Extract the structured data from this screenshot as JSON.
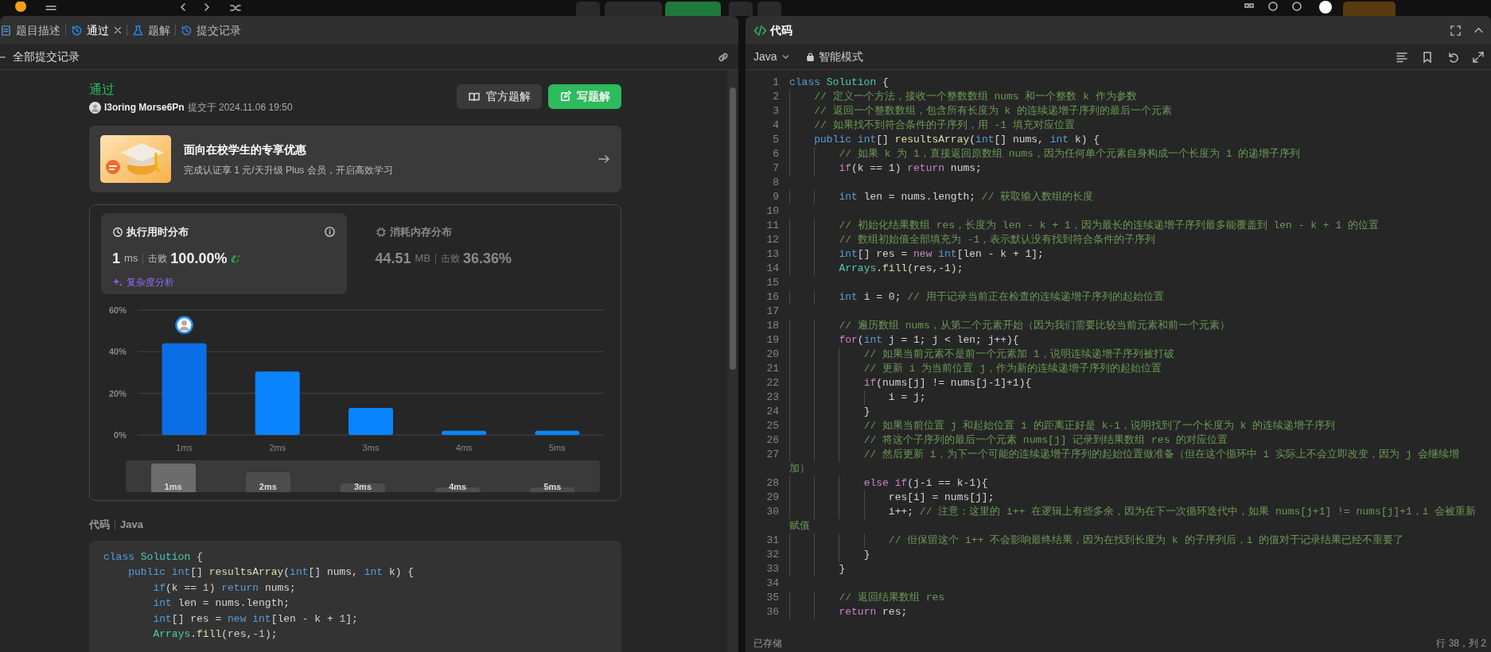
{
  "left_panel": {
    "tabs": [
      {
        "label": "题目描述",
        "kind": "description",
        "selected": false,
        "closable": false
      },
      {
        "label": "通过",
        "kind": "result",
        "selected": true,
        "closable": true
      },
      {
        "label": "题解",
        "kind": "solutions",
        "selected": false,
        "closable": false
      },
      {
        "label": "提交记录",
        "kind": "submissions",
        "selected": false,
        "closable": false
      }
    ],
    "back_link": "全部提交记录",
    "submission": {
      "status": "通过",
      "user": "l3oring Morse6Pn",
      "submitted_at": "提交于 2024.11.06 19:50"
    },
    "buttons": [
      {
        "label": "官方题解",
        "kind": "official"
      },
      {
        "label": "写题解",
        "kind": "write"
      }
    ],
    "promo": {
      "title": "面向在校学生的专享优惠",
      "subtitle": "完成认证享 1 元/天升级 Plus 会员，开启高效学习"
    },
    "stats": [
      {
        "kind": "runtime",
        "selected": true,
        "title": "执行用时分布",
        "value": "1",
        "unit": "ms",
        "beat_label": "击败",
        "percent": "100.00%",
        "link": "复杂度分析"
      },
      {
        "kind": "memory",
        "selected": false,
        "title": "消耗内存分布",
        "value": "44.51",
        "unit": "MB",
        "beat_label": "击败",
        "percent": "36.36%"
      }
    ],
    "runtime_chart": {
      "chart_data": {
        "type": "bar",
        "categories": [
          "1ms",
          "2ms",
          "3ms",
          "4ms",
          "5ms"
        ],
        "values": [
          44,
          30.5,
          13,
          2,
          2
        ],
        "ylim": [
          0,
          60
        ],
        "yticks": [
          {
            "value": 0,
            "label": "0%"
          },
          {
            "value": 20,
            "label": "20%"
          },
          {
            "value": 40,
            "label": "40%"
          },
          {
            "value": 60,
            "label": "60%"
          }
        ]
      },
      "navigator": [
        {
          "label": "1ms",
          "selected": true
        },
        {
          "label": "2ms",
          "selected": false
        },
        {
          "label": "3ms",
          "selected": false
        },
        {
          "label": "4ms",
          "selected": false
        },
        {
          "label": "5ms",
          "selected": false
        }
      ]
    },
    "code_title": "代码",
    "code_language": "Java",
    "code": [
      {
        "tokens": [
          {
            "kind": "keyword",
            "text": "class"
          },
          {
            "kind": "class",
            "text": " Solution"
          },
          {
            "kind": "plain",
            "text": " {"
          }
        ]
      },
      {
        "tokens": [
          {
            "kind": "keyword",
            "text": "    public"
          },
          {
            "kind": "keyword",
            "text": " int"
          },
          {
            "kind": "plain",
            "text": "[] "
          },
          {
            "kind": "function",
            "text": "resultsArray"
          },
          {
            "kind": "plain",
            "text": "("
          },
          {
            "kind": "keyword",
            "text": "int"
          },
          {
            "kind": "plain",
            "text": "[] nums, "
          },
          {
            "kind": "keyword",
            "text": "int"
          },
          {
            "kind": "plain",
            "text": " k) {"
          }
        ]
      },
      {
        "tokens": [
          {
            "kind": "keyword",
            "text": "        if"
          },
          {
            "kind": "plain",
            "text": "(k == "
          },
          {
            "kind": "number",
            "text": "1"
          },
          {
            "kind": "plain",
            "text": ") "
          },
          {
            "kind": "keyword",
            "text": "return"
          },
          {
            "kind": "plain",
            "text": " nums;"
          }
        ]
      },
      {
        "tokens": [
          {
            "kind": "keyword",
            "text": "        int"
          },
          {
            "kind": "plain",
            "text": " len = nums.length;"
          }
        ]
      },
      {
        "tokens": [
          {
            "kind": "keyword",
            "text": "        int"
          },
          {
            "kind": "plain",
            "text": "[] res = "
          },
          {
            "kind": "keyword",
            "text": "new"
          },
          {
            "kind": "keyword",
            "text": " int"
          },
          {
            "kind": "plain",
            "text": "[len - k + "
          },
          {
            "kind": "number",
            "text": "1"
          },
          {
            "kind": "plain",
            "text": "];"
          }
        ]
      },
      {
        "tokens": [
          {
            "kind": "class",
            "text": "        Arrays"
          },
          {
            "kind": "plain",
            "text": "."
          },
          {
            "kind": "function",
            "text": "fill"
          },
          {
            "kind": "plain",
            "text": "(res,-"
          },
          {
            "kind": "number",
            "text": "1"
          },
          {
            "kind": "plain",
            "text": ");"
          }
        ]
      }
    ]
  },
  "editor": {
    "title": "代码",
    "language": "Java",
    "mode": "智能模式",
    "lines": [
      {
        "n": "1",
        "tokens": [
          {
            "kind": "keyword",
            "text": "class"
          },
          {
            "kind": "class",
            "text": " Solution"
          },
          {
            "kind": "plain",
            "text": " {"
          }
        ]
      },
      {
        "n": "2",
        "tokens": [
          {
            "kind": "comment",
            "text": "    // 定义一个方法，接收一个整数数组 nums 和一个整数 k 作为参数"
          }
        ]
      },
      {
        "n": "3",
        "tokens": [
          {
            "kind": "comment",
            "text": "    // 返回一个整数数组，包含所有长度为 k 的连续递增子序列的最后一个元素"
          }
        ]
      },
      {
        "n": "4",
        "tokens": [
          {
            "kind": "comment",
            "text": "    // 如果找不到符合条件的子序列，用 -1 填充对应位置"
          }
        ]
      },
      {
        "n": "5",
        "tokens": [
          {
            "kind": "keyword",
            "text": "    public"
          },
          {
            "kind": "keyword",
            "text": " int"
          },
          {
            "kind": "plain",
            "text": "[] "
          },
          {
            "kind": "function",
            "text": "resultsArray"
          },
          {
            "kind": "plain",
            "text": "("
          },
          {
            "kind": "keyword",
            "text": "int"
          },
          {
            "kind": "plain",
            "text": "[] nums, "
          },
          {
            "kind": "keyword",
            "text": "int"
          },
          {
            "kind": "plain",
            "text": " k) {"
          }
        ]
      },
      {
        "n": "6",
        "tokens": [
          {
            "kind": "comment",
            "text": "        // 如果 k 为 1，直接返回原数组 nums，因为任何单个元素自身构成一个长度为 1 的递增子序列"
          }
        ]
      },
      {
        "n": "7",
        "tokens": [
          {
            "kind": "control",
            "text": "        if"
          },
          {
            "kind": "plain",
            "text": "(k == 1) "
          },
          {
            "kind": "control",
            "text": "return"
          },
          {
            "kind": "plain",
            "text": " nums;"
          }
        ]
      },
      {
        "n": "8"
      },
      {
        "n": "9",
        "tokens": [
          {
            "kind": "keyword",
            "text": "        int"
          },
          {
            "kind": "plain",
            "text": " len = nums.length; "
          },
          {
            "kind": "comment",
            "text": "// 获取输入数组的长度"
          }
        ]
      },
      {
        "n": "10"
      },
      {
        "n": "11",
        "tokens": [
          {
            "kind": "comment",
            "text": "        // 初始化结果数组 res，长度为 len - k + 1，因为最长的连续递增子序列最多能覆盖到 len - k + 1 的位置"
          }
        ]
      },
      {
        "n": "12",
        "tokens": [
          {
            "kind": "comment",
            "text": "        // 数组初始值全部填充为 -1，表示默认没有找到符合条件的子序列"
          }
        ]
      },
      {
        "n": "13",
        "tokens": [
          {
            "kind": "keyword",
            "text": "        int"
          },
          {
            "kind": "plain",
            "text": "[] res = "
          },
          {
            "kind": "control",
            "text": "new"
          },
          {
            "kind": "keyword",
            "text": " int"
          },
          {
            "kind": "plain",
            "text": "[len - k + 1];"
          }
        ]
      },
      {
        "n": "14",
        "tokens": [
          {
            "kind": "class",
            "text": "        Arrays"
          },
          {
            "kind": "plain",
            "text": "."
          },
          {
            "kind": "function",
            "text": "fill"
          },
          {
            "kind": "plain",
            "text": "(res,-1);"
          }
        ]
      },
      {
        "n": "15"
      },
      {
        "n": "16",
        "tokens": [
          {
            "kind": "keyword",
            "text": "        int"
          },
          {
            "kind": "plain",
            "text": " i = 0; "
          },
          {
            "kind": "comment",
            "text": "// 用于记录当前正在检查的连续递增子序列的起始位置"
          }
        ]
      },
      {
        "n": "17"
      },
      {
        "n": "18",
        "tokens": [
          {
            "kind": "comment",
            "text": "        // 遍历数组 nums，从第二个元素开始（因为我们需要比较当前元素和前一个元素）"
          }
        ]
      },
      {
        "n": "19",
        "tokens": [
          {
            "kind": "control",
            "text": "        for"
          },
          {
            "kind": "plain",
            "text": "("
          },
          {
            "kind": "keyword",
            "text": "int"
          },
          {
            "kind": "plain",
            "text": " j = 1; j < len; j++){"
          }
        ]
      },
      {
        "n": "20",
        "tokens": [
          {
            "kind": "comment",
            "text": "            // 如果当前元素不是前一个元素加 1，说明连续递增子序列被打破"
          }
        ]
      },
      {
        "n": "21",
        "tokens": [
          {
            "kind": "comment",
            "text": "            // 更新 i 为当前位置 j，作为新的连续递增子序列的起始位置"
          }
        ]
      },
      {
        "n": "22",
        "tokens": [
          {
            "kind": "control",
            "text": "            if"
          },
          {
            "kind": "plain",
            "text": "(nums[j] != nums[j-1]+1){"
          }
        ]
      },
      {
        "n": "23",
        "tokens": [
          {
            "kind": "plain",
            "text": "                i = j;"
          }
        ]
      },
      {
        "n": "24",
        "tokens": [
          {
            "kind": "plain",
            "text": "            }"
          }
        ]
      },
      {
        "n": "25",
        "tokens": [
          {
            "kind": "comment",
            "text": "            // 如果当前位置 j 和起始位置 i 的距离正好是 k-1，说明找到了一个长度为 k 的连续递增子序列"
          }
        ]
      },
      {
        "n": "26",
        "tokens": [
          {
            "kind": "comment",
            "text": "            // 将这个子序列的最后一个元素 nums[j] 记录到结果数组 res 的对应位置"
          }
        ]
      },
      {
        "n": "27",
        "tokens": [
          {
            "kind": "comment",
            "text": "            // 然后更新 i，为下一个可能的连续递增子序列的起始位置做准备（但在这个循环中 i 实际上不会立即改变，因为 j 会继续增加）"
          }
        ]
      },
      {
        "n": "28",
        "tokens": [
          {
            "kind": "control",
            "text": "            else"
          },
          {
            "kind": "control",
            "text": " if"
          },
          {
            "kind": "plain",
            "text": "(j-i == k-1){"
          }
        ]
      },
      {
        "n": "29",
        "tokens": [
          {
            "kind": "plain",
            "text": "                res[i] = nums[j];"
          }
        ]
      },
      {
        "n": "30",
        "tokens": [
          {
            "kind": "plain",
            "text": "                i++; "
          },
          {
            "kind": "comment",
            "text": "// 注意：这里的 i++ 在逻辑上有些多余，因为在下一次循环迭代中，如果 nums[j+1] != nums[j]+1，i 会被重新赋值"
          }
        ]
      },
      {
        "n": "31",
        "tokens": [
          {
            "kind": "comment",
            "text": "                // 但保留这个 i++ 不会影响最终结果，因为在找到长度为 k 的子序列后，i 的值对于记录结果已经不重要了"
          }
        ]
      },
      {
        "n": "32",
        "tokens": [
          {
            "kind": "plain",
            "text": "            }"
          }
        ]
      },
      {
        "n": "33",
        "tokens": [
          {
            "kind": "plain",
            "text": "        }"
          }
        ]
      },
      {
        "n": "34"
      },
      {
        "n": "35",
        "tokens": [
          {
            "kind": "comment",
            "text": "        // 返回结果数组 res"
          }
        ]
      },
      {
        "n": "36",
        "tokens": [
          {
            "kind": "control",
            "text": "        return"
          },
          {
            "kind": "plain",
            "text": " res;"
          }
        ]
      }
    ],
    "status": "已存储",
    "cursor": "行 38，列 2"
  }
}
